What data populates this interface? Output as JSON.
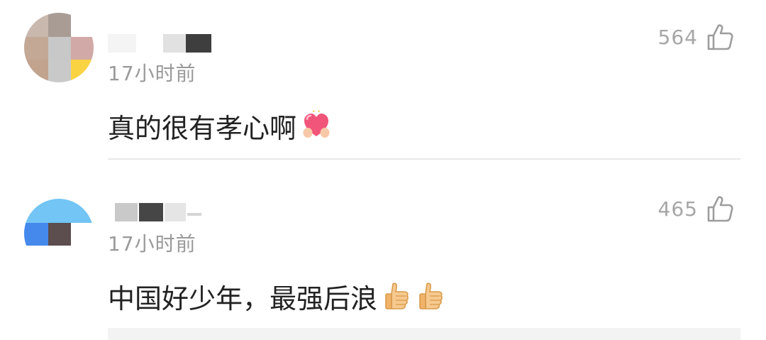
{
  "comments": [
    {
      "time": "17小时前",
      "likes": "564",
      "text": "真的很有孝心啊",
      "emojis": [
        "heart-hands-emoji"
      ]
    },
    {
      "time": "17小时前",
      "likes": "465",
      "text": "中国好少年，最强后浪",
      "emojis": [
        "thumbs-up-emoji",
        "thumbs-up-emoji"
      ]
    }
  ],
  "icons": {
    "like": "thumbs-up-outline-icon"
  },
  "colors": {
    "secondary_text": "#9a9a9a",
    "primary_text": "#222222",
    "divider": "#e8e8e8"
  }
}
